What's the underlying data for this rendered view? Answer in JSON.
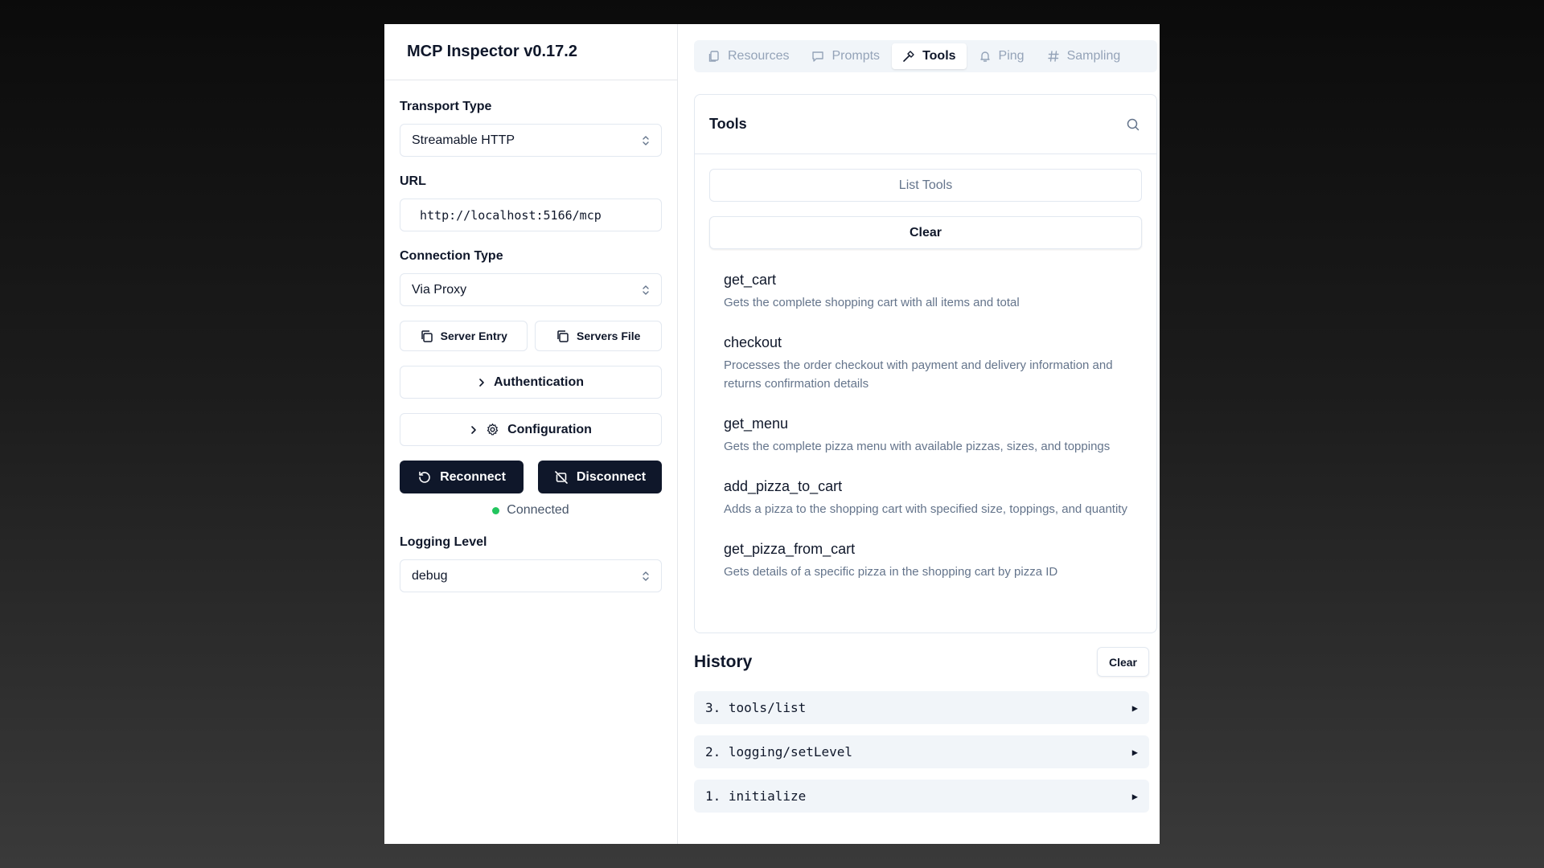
{
  "app": {
    "title": "MCP Inspector v0.17.2"
  },
  "sidebar": {
    "transport": {
      "label": "Transport Type",
      "value": "Streamable HTTP"
    },
    "url": {
      "label": "URL",
      "value": "http://localhost:5166/mcp"
    },
    "connection": {
      "label": "Connection Type",
      "value": "Via Proxy"
    },
    "server_entry_label": "Server Entry",
    "servers_file_label": "Servers File",
    "authentication_label": "Authentication",
    "configuration_label": "Configuration",
    "reconnect_label": "Reconnect",
    "disconnect_label": "Disconnect",
    "status_text": "Connected",
    "status_color": "#22c55e",
    "logging": {
      "label": "Logging Level",
      "value": "debug"
    }
  },
  "tabs": [
    {
      "label": "Resources",
      "icon": "files-icon"
    },
    {
      "label": "Prompts",
      "icon": "message-icon"
    },
    {
      "label": "Tools",
      "icon": "hammer-icon",
      "active": true
    },
    {
      "label": "Ping",
      "icon": "bell-icon"
    },
    {
      "label": "Sampling",
      "icon": "hash-icon"
    }
  ],
  "tools_panel": {
    "title": "Tools",
    "list_label": "List Tools",
    "clear_label": "Clear",
    "items": [
      {
        "name": "get_cart",
        "description": "Gets the complete shopping cart with all items and total"
      },
      {
        "name": "checkout",
        "description": "Processes the order checkout with payment and delivery information and returns confirmation details"
      },
      {
        "name": "get_menu",
        "description": "Gets the complete pizza menu with available pizzas, sizes, and toppings"
      },
      {
        "name": "add_pizza_to_cart",
        "description": "Adds a pizza to the shopping cart with specified size, toppings, and quantity"
      },
      {
        "name": "get_pizza_from_cart",
        "description": "Gets details of a specific pizza in the shopping cart by pizza ID"
      }
    ]
  },
  "history": {
    "title": "History",
    "clear_label": "Clear",
    "items": [
      {
        "label": "3. tools/list"
      },
      {
        "label": "2. logging/setLevel"
      },
      {
        "label": "1. initialize"
      }
    ]
  }
}
